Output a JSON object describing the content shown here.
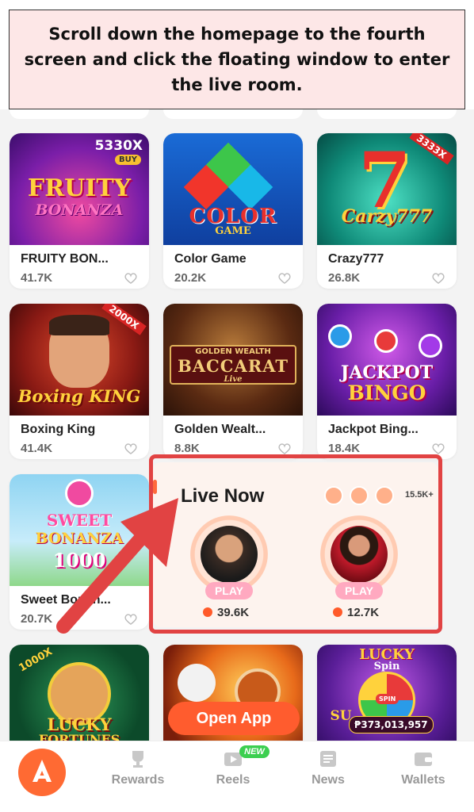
{
  "instruction": "Scroll down the homepage to the fourth screen and click the floating window to enter the live room.",
  "games": [
    {
      "title": "FRUITY BON...",
      "count": "41.7K",
      "art_title": "FRUITY",
      "art_sub": "BONANZA",
      "badge": "5330X",
      "badge2": "BUY"
    },
    {
      "title": "Color Game",
      "count": "20.2K",
      "art_title": "COLOR",
      "art_sub": "GAME"
    },
    {
      "title": "Crazy777",
      "count": "26.8K",
      "art_title": "Carzy777",
      "badge": "3333X"
    },
    {
      "title": "Boxing King",
      "count": "41.4K",
      "art_title": "Boxing KING",
      "badge": "2000X"
    },
    {
      "title": "Golden Wealt...",
      "count": "8.8K",
      "art_title": "BACCARAT",
      "art_sub": "GOLDEN WEALTH",
      "art_sub2": "Live"
    },
    {
      "title": "Jackpot Bing...",
      "count": "18.4K",
      "art_title": "JACKPOT",
      "art_sub": "BINGO"
    },
    {
      "title": "Sweet Bonan...",
      "count": "20.7K",
      "art_title": "SWEET",
      "art_sub": "BONANZA",
      "art_sub2": "1000"
    },
    {
      "art_title": "LUCKY",
      "art_sub": "FORTUNES",
      "badge": "1000X"
    },
    {
      "art_title": "Open App"
    },
    {
      "art_title": "LUCKY",
      "art_sub": "Spin",
      "badge": "₱373,013,957",
      "badge2": "SPIN",
      "art_sub2": "SU"
    }
  ],
  "live": {
    "title": "Live Now",
    "viewers_total": "15.5K+",
    "streamers": [
      {
        "play": "PLAY",
        "viewers": "39.6K"
      },
      {
        "play": "PLAY",
        "viewers": "12.7K"
      }
    ]
  },
  "open_app": "Open App",
  "tabs": [
    {
      "label": "Rewards",
      "icon": "trophy-icon"
    },
    {
      "label": "Reels",
      "icon": "reels-icon",
      "badge": "NEW"
    },
    {
      "label": "News",
      "icon": "news-icon"
    },
    {
      "label": "Wallets",
      "icon": "wallet-icon"
    }
  ],
  "colors": {
    "accent": "#ff6a33",
    "highlight": "#e14343",
    "play": "#ffa9c0"
  }
}
